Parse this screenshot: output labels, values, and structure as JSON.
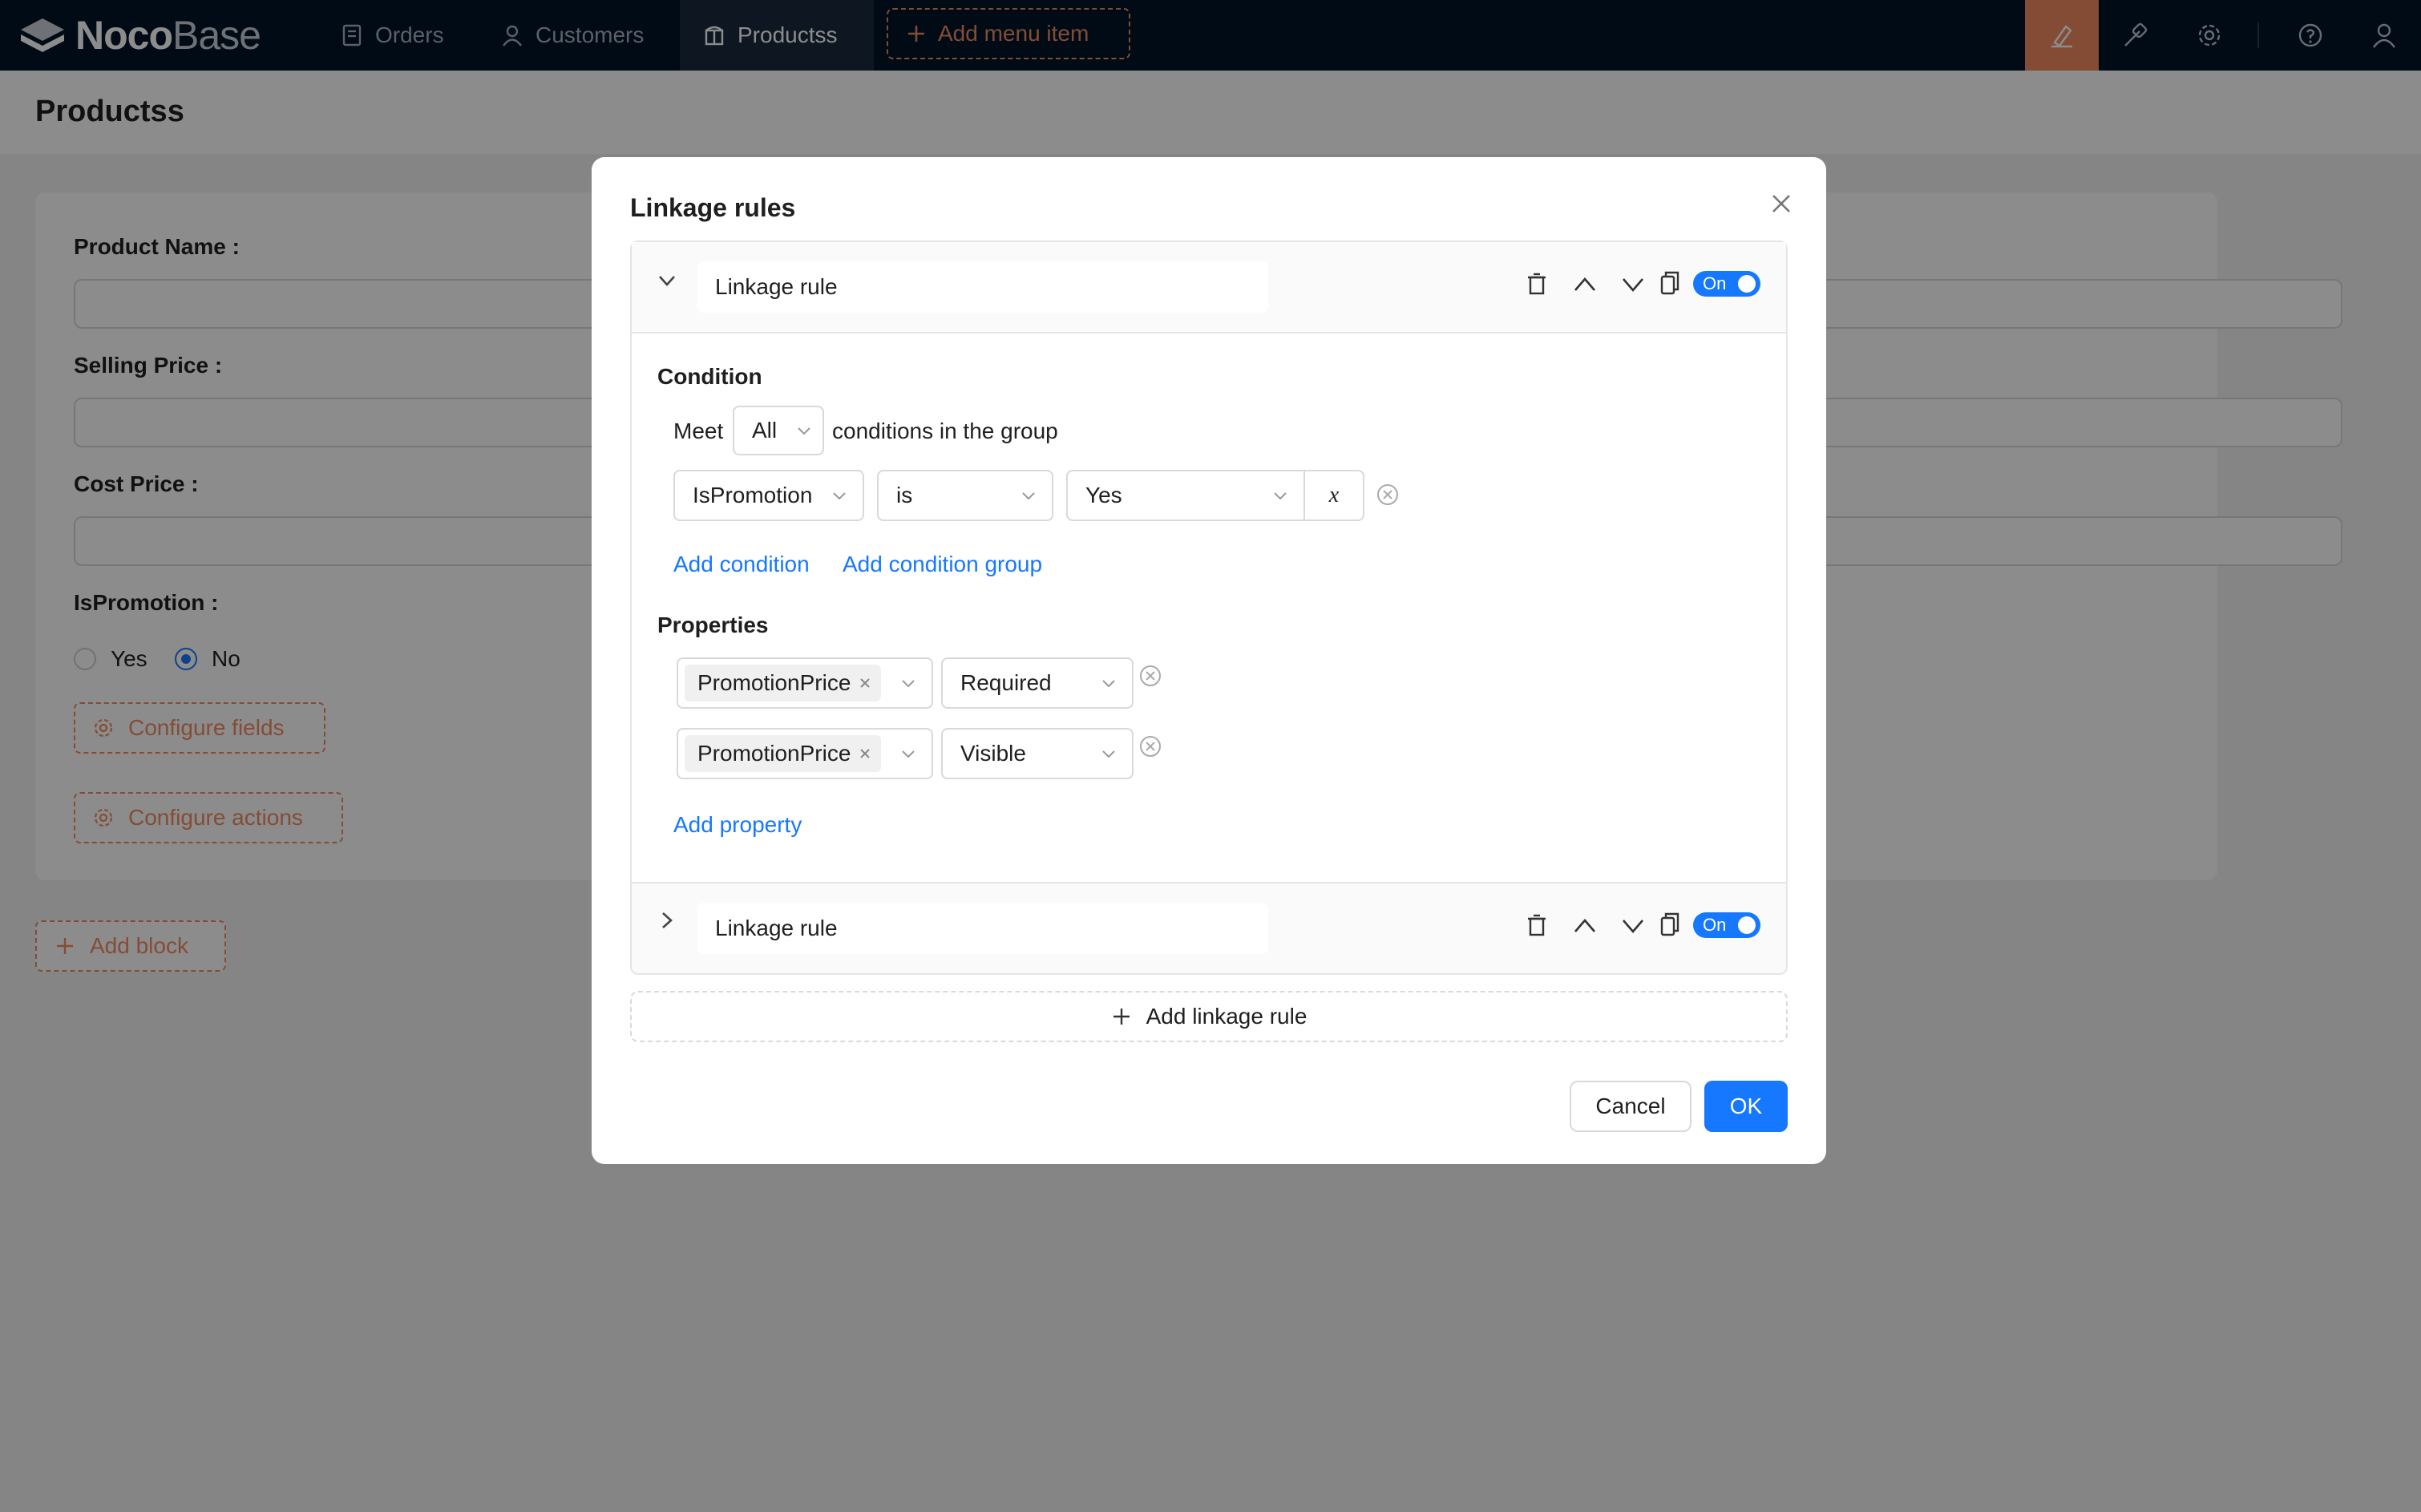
{
  "app": {
    "name_bold": "Noco",
    "name_thin": "Base"
  },
  "nav": {
    "items": [
      {
        "label": "Orders",
        "icon": "file-icon"
      },
      {
        "label": "Customers",
        "icon": "user-icon"
      },
      {
        "label": "Productss",
        "icon": "box-icon"
      }
    ],
    "add_menu_label": "Add menu item"
  },
  "page": {
    "title": "Productss"
  },
  "form": {
    "fields": {
      "product_name": "Product Name",
      "selling_price": "Selling Price",
      "cost_price": "Cost Price",
      "is_promotion": "IsPromotion"
    },
    "radio_yes": "Yes",
    "radio_no": "No",
    "radio_selected": "No",
    "configure_fields": "Configure fields",
    "configure_actions": "Configure actions",
    "add_block": "Add block"
  },
  "modal": {
    "title": "Linkage rules",
    "rules": [
      {
        "name": "Linkage rule",
        "expanded": true,
        "toggle": "On",
        "condition_label": "Condition",
        "meet_prefix": "Meet",
        "meet_value": "All",
        "meet_suffix": "conditions in the group",
        "condition": {
          "field": "IsPromotion",
          "operator": "is",
          "value": "Yes",
          "var": "x"
        },
        "add_condition": "Add condition",
        "add_condition_group": "Add condition group",
        "properties_label": "Properties",
        "properties": [
          {
            "field": "PromotionPrice",
            "property": "Required"
          },
          {
            "field": "PromotionPrice",
            "property": "Visible"
          }
        ],
        "add_property": "Add property"
      },
      {
        "name": "Linkage rule",
        "expanded": false,
        "toggle": "On"
      }
    ],
    "add_rule": "Add linkage rule",
    "cancel": "Cancel",
    "ok": "OK"
  },
  "colors": {
    "brand_accent": "#f18b62",
    "primary": "#1677ff",
    "topbar": "#001529"
  }
}
